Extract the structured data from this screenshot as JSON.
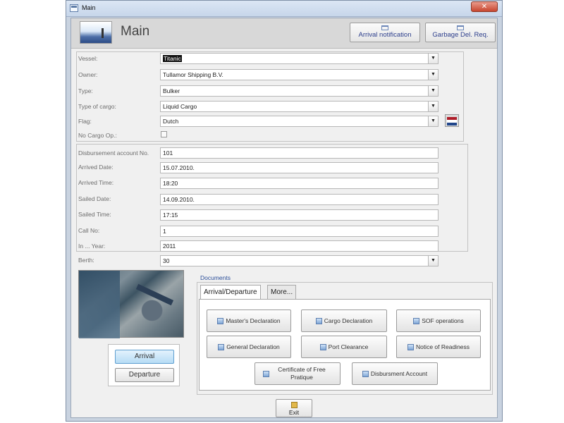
{
  "window": {
    "title": "Main"
  },
  "header": {
    "title": "Main",
    "buttons": [
      "Arrival notification",
      "Garbage Del. Req."
    ]
  },
  "vessel_info": {
    "vessel_label": "Vessel:",
    "vessel_value": "Titanic",
    "owner_label": "Owner:",
    "owner_value": "Tullamor Shipping B.V.",
    "type_label": "Type:",
    "type_value": "Bulker",
    "cargo_label": "Type of cargo:",
    "cargo_value": "Liquid Cargo",
    "flag_label": "Flag:",
    "flag_value": "Dutch",
    "flag_colors": [
      "#ae1c28",
      "#ffffff",
      "#21468b"
    ],
    "no_cargo_label": "No Cargo Op.:"
  },
  "call_info": {
    "disb_label": "Disbursement account No.",
    "disb_value": "101",
    "arrived_date_label": "Arrived Date:",
    "arrived_date_value": "15.07.2010.",
    "arrived_time_label": "Arrived Time:",
    "arrived_time_value": "18:20",
    "sailed_date_label": "Sailed Date:",
    "sailed_date_value": "14.09.2010.",
    "sailed_time_label": "Sailed Time:",
    "sailed_time_value": "17:15",
    "call_no_label": "Call No:",
    "call_no_value": "1",
    "year_label": "In ... Year:",
    "year_value": "2011"
  },
  "berth": {
    "label": "Berth:",
    "value": "30"
  },
  "nav": {
    "arrival": "Arrival",
    "departure": "Departure"
  },
  "documents": {
    "label": "Documents",
    "tabs": [
      "Arrival/Departure",
      "More..."
    ],
    "buttons": [
      "Master's Declaration",
      "Cargo Declaration",
      "SOF operations",
      "General Declaration",
      "Port Clearance",
      "Notice of Readiness",
      "Certificate of Free Pratique",
      "Disbursment Account"
    ]
  },
  "exit_label": "Exit",
  "colors": {
    "accent": "#2c3e8c",
    "active_button": "#b6dcf5",
    "window_frame": "#c9d3e0"
  }
}
